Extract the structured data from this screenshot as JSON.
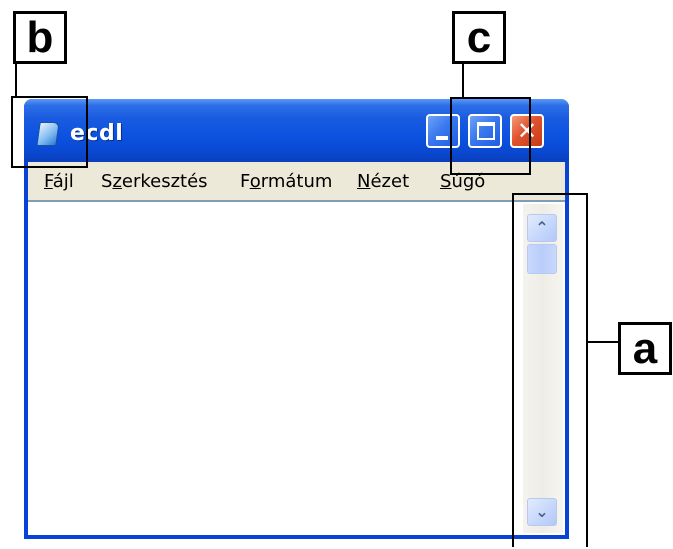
{
  "callouts": {
    "a": "a",
    "b": "b",
    "c": "c"
  },
  "window": {
    "title": "ecdl",
    "controls": {
      "minimize": "_",
      "maximize": "□",
      "close": "✕"
    }
  },
  "menu": [
    {
      "accel": "F",
      "rest": "ájl"
    },
    {
      "pre": "S",
      "accel": "z",
      "rest": "erkesztés"
    },
    {
      "pre": "F",
      "accel": "o",
      "rest": "rmátum"
    },
    {
      "accel": "N",
      "rest": "ézet"
    },
    {
      "accel": "S",
      "rest": "úgó"
    }
  ],
  "scrollbar": {
    "up": "⌃",
    "down": "⌄"
  },
  "icons": {
    "app": "notepad-icon",
    "minimize": "minimize-icon",
    "maximize": "maximize-icon",
    "close": "close-icon"
  },
  "colors": {
    "titlebar": "#0b52e0",
    "menubar": "#ece9d8",
    "close": "#e0532f"
  }
}
